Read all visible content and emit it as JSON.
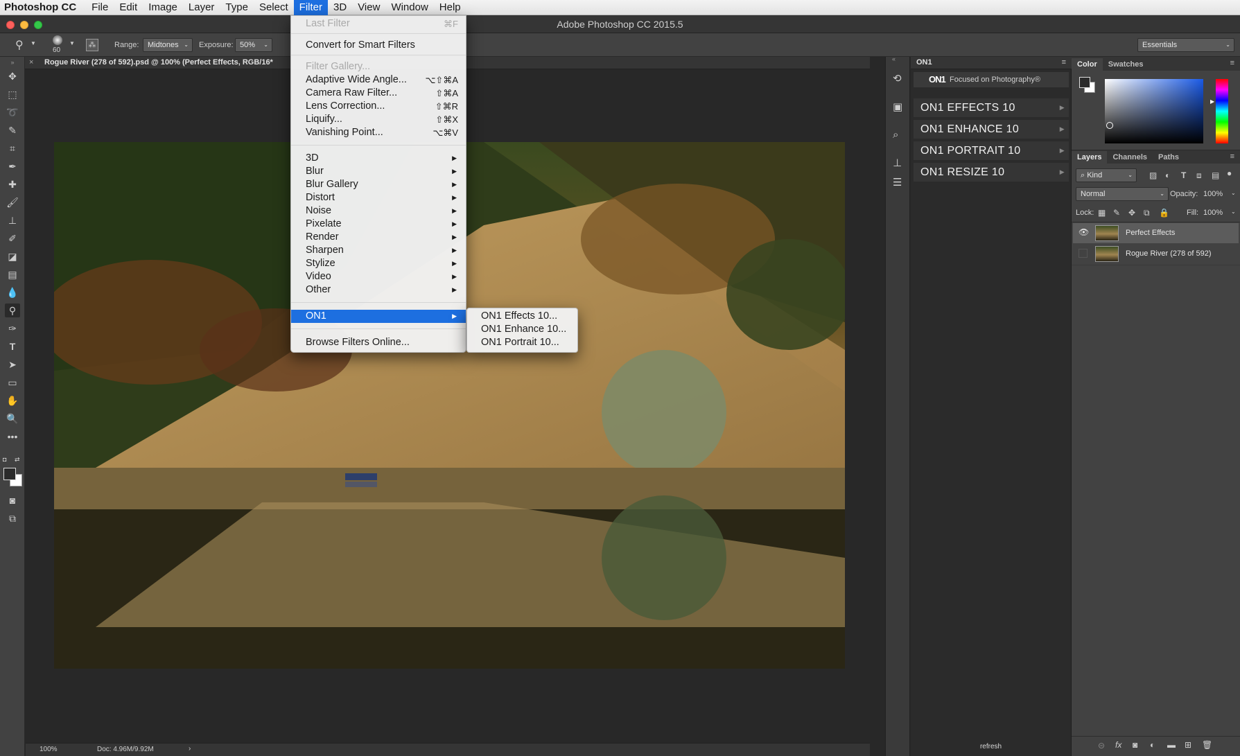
{
  "menubar": {
    "app": "Photoshop CC",
    "items": [
      "File",
      "Edit",
      "Image",
      "Layer",
      "Type",
      "Select",
      "Filter",
      "3D",
      "View",
      "Window",
      "Help"
    ],
    "active": "Filter"
  },
  "window": {
    "title": "Adobe Photoshop CC 2015.5"
  },
  "options_bar": {
    "brush_size": "60",
    "range_label": "Range:",
    "range_value": "Midtones",
    "exposure_label": "Exposure:",
    "exposure_value": "50%",
    "workspace": "Essentials"
  },
  "document": {
    "tab_title": "Rogue River (278 of 592).psd @ 100% (Perfect Effects, RGB/16*",
    "zoom": "100%",
    "doc_info": "Doc: 4.96M/9.92M"
  },
  "filter_menu": {
    "last_filter": "Last Filter",
    "last_filter_shortcut": "⌘F",
    "convert": "Convert for Smart Filters",
    "filter_gallery": "Filter Gallery...",
    "items": [
      {
        "label": "Adaptive Wide Angle...",
        "shortcut": "⌥⇧⌘A"
      },
      {
        "label": "Camera Raw Filter...",
        "shortcut": "⇧⌘A"
      },
      {
        "label": "Lens Correction...",
        "shortcut": "⇧⌘R"
      },
      {
        "label": "Liquify...",
        "shortcut": "⇧⌘X"
      },
      {
        "label": "Vanishing Point...",
        "shortcut": "⌥⌘V"
      }
    ],
    "submenus": [
      "3D",
      "Blur",
      "Blur Gallery",
      "Distort",
      "Noise",
      "Pixelate",
      "Render",
      "Sharpen",
      "Stylize",
      "Video",
      "Other"
    ],
    "on1": "ON1",
    "browse": "Browse Filters Online..."
  },
  "on1_submenu": [
    "ON1 Effects 10...",
    "ON1 Enhance 10...",
    "ON1 Portrait 10..."
  ],
  "on1_panel": {
    "title": "ON1",
    "logo": "ON1",
    "tagline": "Focused on Photography®",
    "buttons": [
      "ON1 EFFECTS 10",
      "ON1 ENHANCE 10",
      "ON1 PORTRAIT 10",
      "ON1 RESIZE 10"
    ],
    "refresh": "refresh"
  },
  "color_panel": {
    "tabs": [
      "Color",
      "Swatches"
    ]
  },
  "layers_panel": {
    "tabs": [
      "Layers",
      "Channels",
      "Paths"
    ],
    "kind": "Kind",
    "blend_mode": "Normal",
    "opacity_label": "Opacity:",
    "opacity": "100%",
    "lock_label": "Lock:",
    "fill_label": "Fill:",
    "fill": "100%",
    "layers": [
      {
        "name": "Perfect Effects",
        "visible": true,
        "selected": true
      },
      {
        "name": "Rogue River (278 of 592)",
        "visible": false,
        "selected": false
      }
    ]
  }
}
